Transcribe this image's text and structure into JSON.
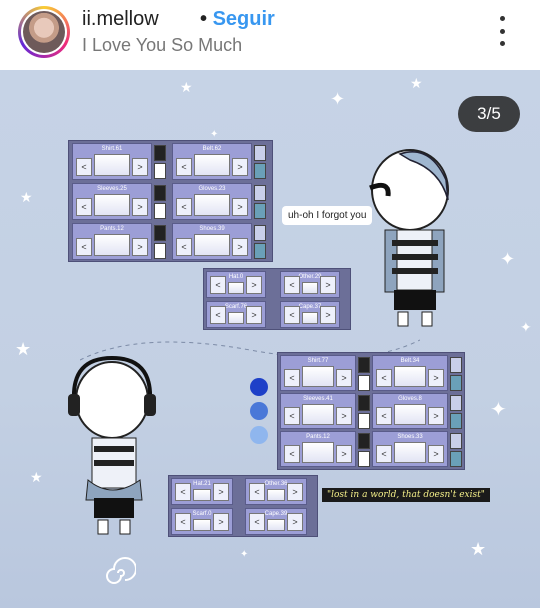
{
  "header": {
    "username": "ii.mellow",
    "dot": "•",
    "follow": "Seguir",
    "subtitle": "I Love You So Much",
    "menu_icon": "more-vert-icon"
  },
  "post": {
    "counter": "3/5",
    "bubble": "uh-oh I forgot you",
    "quote": "\"lost in a world, that doesn't exist\"",
    "top_grid": [
      "Shirt.61",
      "Belt.62",
      "Sleeves.25",
      "Gloves.23",
      "Pants.12",
      "Shoes.39"
    ],
    "top_small": [
      "Hat.0",
      "Other.29",
      "Scarf.76",
      "Cape.37"
    ],
    "bottom_grid": [
      "Shirt.77",
      "Belt.34",
      "Sleeves.41",
      "Gloves.8",
      "Pants.12",
      "Shoes.33"
    ],
    "bottom_small": [
      "Hat.21",
      "Other.36",
      "Scarf.0",
      "Cape.39"
    ],
    "arrow_left": "<",
    "arrow_right": ">",
    "colors": [
      "#1e40c8",
      "#4a78d8",
      "#8fb6ee"
    ]
  }
}
